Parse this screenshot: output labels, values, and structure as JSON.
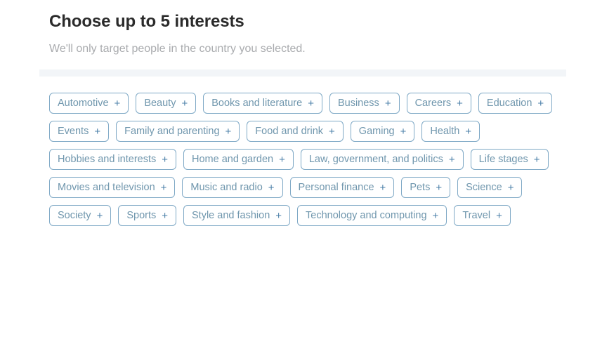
{
  "header": {
    "title": "Choose up to 5 interests",
    "subtitle": "We'll only target people in the country you selected."
  },
  "progress": {
    "band_color": "#f2f5f8"
  },
  "theme": {
    "chip_border": "#7fa9c6",
    "chip_text": "#6f96ad",
    "chip_plus": "#4a7fa8",
    "title_color": "#2b2b2b",
    "subtitle_color": "#a9abae",
    "background": "#ffffff"
  },
  "interests": {
    "add_glyph": "+",
    "max_selectable": 5,
    "items": [
      {
        "label": "Automotive"
      },
      {
        "label": "Beauty"
      },
      {
        "label": "Books and literature"
      },
      {
        "label": "Business"
      },
      {
        "label": "Careers"
      },
      {
        "label": "Education"
      },
      {
        "label": "Events"
      },
      {
        "label": "Family and parenting"
      },
      {
        "label": "Food and drink"
      },
      {
        "label": "Gaming"
      },
      {
        "label": "Health"
      },
      {
        "label": "Hobbies and interests"
      },
      {
        "label": "Home and garden"
      },
      {
        "label": "Law, government, and politics"
      },
      {
        "label": "Life stages"
      },
      {
        "label": "Movies and television"
      },
      {
        "label": "Music and radio"
      },
      {
        "label": "Personal finance"
      },
      {
        "label": "Pets"
      },
      {
        "label": "Science"
      },
      {
        "label": "Society"
      },
      {
        "label": "Sports"
      },
      {
        "label": "Style and fashion"
      },
      {
        "label": "Technology and computing"
      },
      {
        "label": "Travel"
      }
    ]
  }
}
